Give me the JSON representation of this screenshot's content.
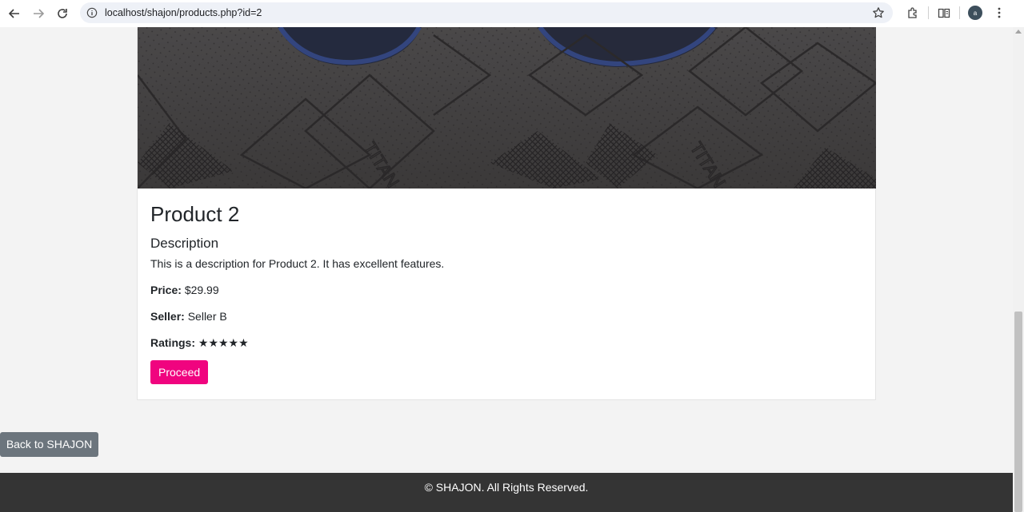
{
  "browser": {
    "url": "localhost/shajon/products.php?id=2",
    "avatar_letter": "a"
  },
  "product": {
    "title": "Product 2",
    "description_heading": "Description",
    "description": "This is a description for Product 2. It has excellent features.",
    "price_label": "Price:",
    "price_value": "$29.99",
    "seller_label": "Seller:",
    "seller_value": "Seller B",
    "ratings_label": "Ratings:",
    "ratings_value": "★★★★★",
    "rating_stars": 5,
    "proceed_label": "Proceed"
  },
  "back_label": "Back to SHAJON",
  "footer_text": "© SHAJON. All Rights Reserved.",
  "colors": {
    "accent": "#f0047f",
    "back_button": "#6c757d",
    "footer_bg": "#343434"
  },
  "icons": [
    "back-arrow-icon",
    "forward-arrow-icon",
    "reload-icon",
    "info-icon",
    "star-bookmark-icon",
    "extensions-icon",
    "reading-mode-icon",
    "menu-icon"
  ]
}
